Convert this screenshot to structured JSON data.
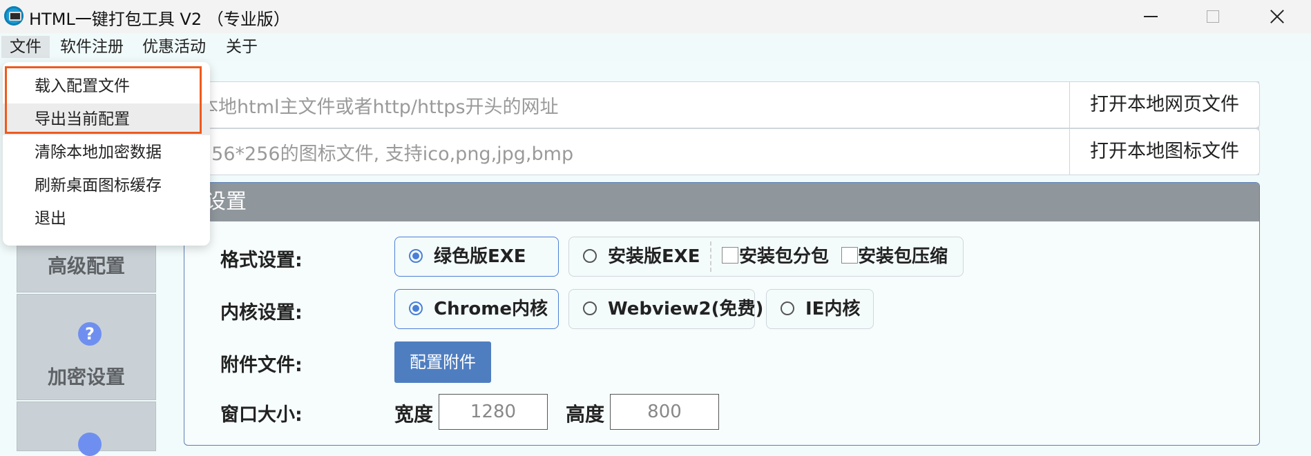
{
  "window": {
    "title": "HTML一键打包工具 V2 （专业版）"
  },
  "menubar": {
    "items": [
      {
        "label": "文件"
      },
      {
        "label": "软件注册"
      },
      {
        "label": "优惠活动"
      },
      {
        "label": "关于"
      }
    ]
  },
  "file_menu": {
    "items": [
      {
        "label": "载入配置文件"
      },
      {
        "label": "导出当前配置"
      },
      {
        "label": "清除本地加密数据"
      },
      {
        "label": "刷新桌面图标缓存"
      },
      {
        "label": "退出"
      }
    ]
  },
  "inputs": {
    "url_placeholder": "本地html主文件或者http/https开头的网址",
    "open_web_label": "打开本地网页文件",
    "icon_placeholder": "256*256的图标文件, 支持ico,png,jpg,bmp",
    "open_icon_label": "打开本地图标文件"
  },
  "sidebar": {
    "items": [
      {
        "label": "高级配置"
      },
      {
        "label": "加密设置",
        "icon": "question-icon"
      }
    ]
  },
  "panel": {
    "header": "设置",
    "format": {
      "label": "格式设置:",
      "options": [
        "绿色版EXE",
        "安装版EXE"
      ],
      "selected": "绿色版EXE",
      "checkboxes": [
        {
          "label": "安装包分包",
          "checked": false
        },
        {
          "label": "安装包压缩",
          "checked": false
        }
      ]
    },
    "kernel": {
      "label": "内核设置:",
      "options": [
        "Chrome内核",
        "Webview2(免费)",
        "IE内核"
      ],
      "selected": "Chrome内核"
    },
    "attachment": {
      "label": "附件文件:",
      "button": "配置附件"
    },
    "window_size": {
      "label": "窗口大小:",
      "width_label": "宽度",
      "width_value": "1280",
      "height_label": "高度",
      "height_value": "800"
    }
  },
  "colors": {
    "accent": "#4a7fd8",
    "highlight": "#ee5a1c",
    "panel_header": "#8f969c",
    "attach_button": "#4f7ec0"
  }
}
